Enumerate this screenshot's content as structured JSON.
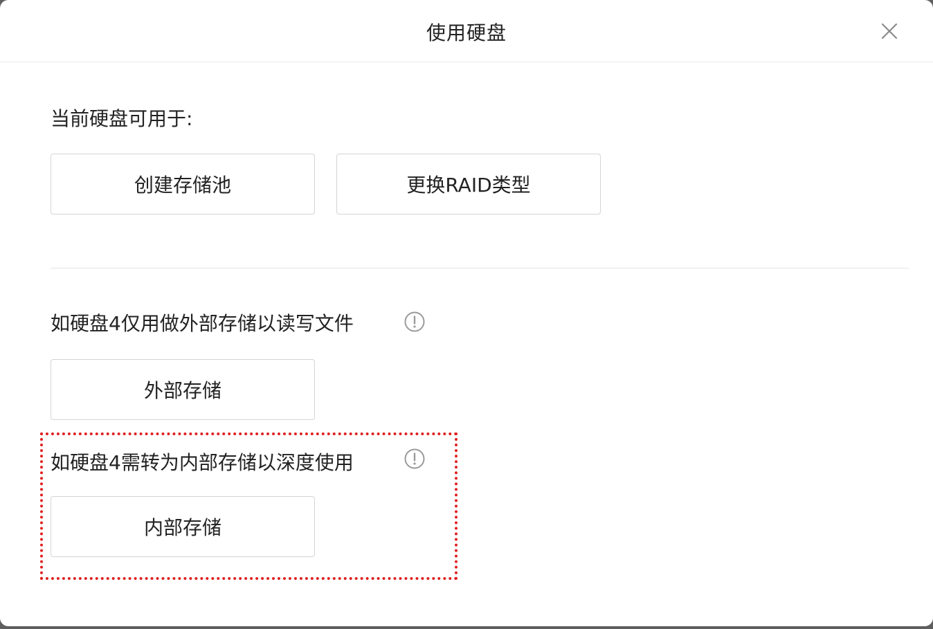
{
  "dialog": {
    "title": "使用硬盘",
    "close_icon": "close-icon"
  },
  "sections": {
    "usable_for_label": "当前硬盘可用于:",
    "create_pool_button": "创建存储池",
    "change_raid_button": "更换RAID类型",
    "external_label": "如硬盘4仅用做外部存储以读写文件",
    "external_button": "外部存储",
    "internal_label": "如硬盘4需转为内部存储以深度使用",
    "internal_button": "内部存储"
  },
  "colors": {
    "highlight": "#e02020",
    "text": "#222222",
    "border": "#d4d4d4"
  }
}
